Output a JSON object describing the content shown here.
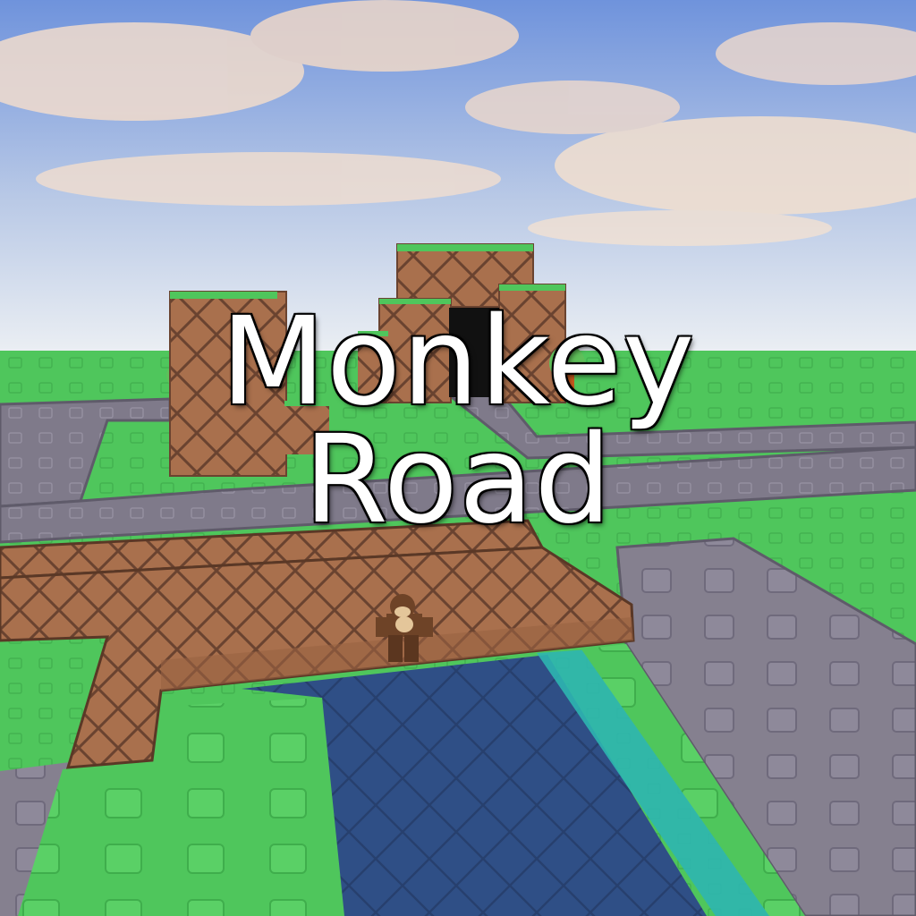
{
  "title": {
    "line1": "Monkey",
    "line2": "Road"
  },
  "scene": {
    "sky_top": "#7d9fe0",
    "sky_horizon": "#e9eef4",
    "grass": "#4fc65c",
    "grass_dark": "#3fae4c",
    "road": "#7f7a8a",
    "road_edge": "#5f5b6a",
    "dirt": "#a9704d",
    "dirt_dark": "#7b4d33",
    "water": "#2f4f86",
    "water_edge": "#2db5b0",
    "tree": "#5fc05a",
    "monkey": "#6e4327"
  }
}
